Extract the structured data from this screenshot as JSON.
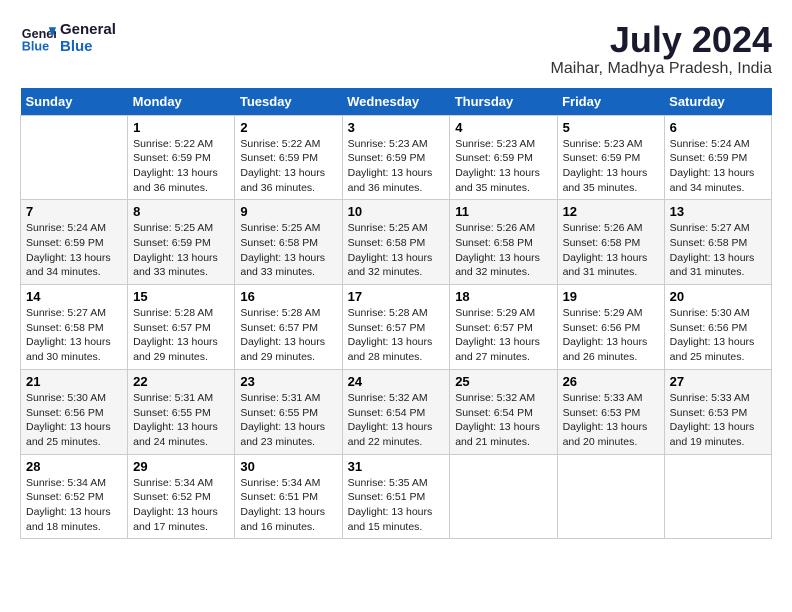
{
  "logo": {
    "line1": "General",
    "line2": "Blue"
  },
  "title": "July 2024",
  "location": "Maihar, Madhya Pradesh, India",
  "days_of_week": [
    "Sunday",
    "Monday",
    "Tuesday",
    "Wednesday",
    "Thursday",
    "Friday",
    "Saturday"
  ],
  "weeks": [
    [
      {
        "num": "",
        "empty": true
      },
      {
        "num": "1",
        "sunrise": "5:22 AM",
        "sunset": "6:59 PM",
        "daylight": "13 hours and 36 minutes."
      },
      {
        "num": "2",
        "sunrise": "5:22 AM",
        "sunset": "6:59 PM",
        "daylight": "13 hours and 36 minutes."
      },
      {
        "num": "3",
        "sunrise": "5:23 AM",
        "sunset": "6:59 PM",
        "daylight": "13 hours and 36 minutes."
      },
      {
        "num": "4",
        "sunrise": "5:23 AM",
        "sunset": "6:59 PM",
        "daylight": "13 hours and 35 minutes."
      },
      {
        "num": "5",
        "sunrise": "5:23 AM",
        "sunset": "6:59 PM",
        "daylight": "13 hours and 35 minutes."
      },
      {
        "num": "6",
        "sunrise": "5:24 AM",
        "sunset": "6:59 PM",
        "daylight": "13 hours and 34 minutes."
      }
    ],
    [
      {
        "num": "7",
        "sunrise": "5:24 AM",
        "sunset": "6:59 PM",
        "daylight": "13 hours and 34 minutes."
      },
      {
        "num": "8",
        "sunrise": "5:25 AM",
        "sunset": "6:59 PM",
        "daylight": "13 hours and 33 minutes."
      },
      {
        "num": "9",
        "sunrise": "5:25 AM",
        "sunset": "6:58 PM",
        "daylight": "13 hours and 33 minutes."
      },
      {
        "num": "10",
        "sunrise": "5:25 AM",
        "sunset": "6:58 PM",
        "daylight": "13 hours and 32 minutes."
      },
      {
        "num": "11",
        "sunrise": "5:26 AM",
        "sunset": "6:58 PM",
        "daylight": "13 hours and 32 minutes."
      },
      {
        "num": "12",
        "sunrise": "5:26 AM",
        "sunset": "6:58 PM",
        "daylight": "13 hours and 31 minutes."
      },
      {
        "num": "13",
        "sunrise": "5:27 AM",
        "sunset": "6:58 PM",
        "daylight": "13 hours and 31 minutes."
      }
    ],
    [
      {
        "num": "14",
        "sunrise": "5:27 AM",
        "sunset": "6:58 PM",
        "daylight": "13 hours and 30 minutes."
      },
      {
        "num": "15",
        "sunrise": "5:28 AM",
        "sunset": "6:57 PM",
        "daylight": "13 hours and 29 minutes."
      },
      {
        "num": "16",
        "sunrise": "5:28 AM",
        "sunset": "6:57 PM",
        "daylight": "13 hours and 29 minutes."
      },
      {
        "num": "17",
        "sunrise": "5:28 AM",
        "sunset": "6:57 PM",
        "daylight": "13 hours and 28 minutes."
      },
      {
        "num": "18",
        "sunrise": "5:29 AM",
        "sunset": "6:57 PM",
        "daylight": "13 hours and 27 minutes."
      },
      {
        "num": "19",
        "sunrise": "5:29 AM",
        "sunset": "6:56 PM",
        "daylight": "13 hours and 26 minutes."
      },
      {
        "num": "20",
        "sunrise": "5:30 AM",
        "sunset": "6:56 PM",
        "daylight": "13 hours and 25 minutes."
      }
    ],
    [
      {
        "num": "21",
        "sunrise": "5:30 AM",
        "sunset": "6:56 PM",
        "daylight": "13 hours and 25 minutes."
      },
      {
        "num": "22",
        "sunrise": "5:31 AM",
        "sunset": "6:55 PM",
        "daylight": "13 hours and 24 minutes."
      },
      {
        "num": "23",
        "sunrise": "5:31 AM",
        "sunset": "6:55 PM",
        "daylight": "13 hours and 23 minutes."
      },
      {
        "num": "24",
        "sunrise": "5:32 AM",
        "sunset": "6:54 PM",
        "daylight": "13 hours and 22 minutes."
      },
      {
        "num": "25",
        "sunrise": "5:32 AM",
        "sunset": "6:54 PM",
        "daylight": "13 hours and 21 minutes."
      },
      {
        "num": "26",
        "sunrise": "5:33 AM",
        "sunset": "6:53 PM",
        "daylight": "13 hours and 20 minutes."
      },
      {
        "num": "27",
        "sunrise": "5:33 AM",
        "sunset": "6:53 PM",
        "daylight": "13 hours and 19 minutes."
      }
    ],
    [
      {
        "num": "28",
        "sunrise": "5:34 AM",
        "sunset": "6:52 PM",
        "daylight": "13 hours and 18 minutes."
      },
      {
        "num": "29",
        "sunrise": "5:34 AM",
        "sunset": "6:52 PM",
        "daylight": "13 hours and 17 minutes."
      },
      {
        "num": "30",
        "sunrise": "5:34 AM",
        "sunset": "6:51 PM",
        "daylight": "13 hours and 16 minutes."
      },
      {
        "num": "31",
        "sunrise": "5:35 AM",
        "sunset": "6:51 PM",
        "daylight": "13 hours and 15 minutes."
      },
      {
        "num": "",
        "empty": true
      },
      {
        "num": "",
        "empty": true
      },
      {
        "num": "",
        "empty": true
      }
    ]
  ],
  "labels": {
    "sunrise": "Sunrise:",
    "sunset": "Sunset:",
    "daylight": "Daylight:"
  }
}
